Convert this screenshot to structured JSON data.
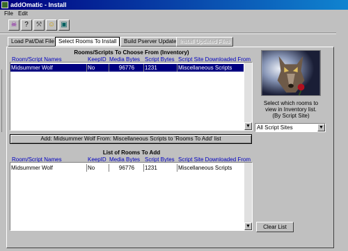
{
  "window": {
    "title": "addOmatic - Install"
  },
  "menu": {
    "file": "File",
    "edit": "Edit"
  },
  "toolbar": {
    "buttons": [
      {
        "icon": "basket-icon",
        "glyph": "☠"
      },
      {
        "icon": "help-icon",
        "glyph": "?"
      },
      {
        "icon": "tools-icon",
        "glyph": "⚒"
      },
      {
        "icon": "smiley-icon",
        "glyph": "☺"
      },
      {
        "icon": "screen-icon",
        "glyph": "▣"
      }
    ]
  },
  "tabs": [
    {
      "label": "Load Pat/Dat File",
      "state": "normal"
    },
    {
      "label": "Select Rooms To Install",
      "state": "active"
    },
    {
      "label": "Build Pserver Update",
      "state": "normal"
    },
    {
      "label": "Install Updated Files",
      "state": "disabled"
    }
  ],
  "inventory": {
    "title": "Rooms/Scripts To Choose From (Inventory)",
    "columns": [
      "Room/Script Names",
      "KeepID",
      "Media Bytes",
      "Script Bytes",
      "Script Site Downloaded From"
    ],
    "rows": [
      {
        "name": "Midsummer Wolf",
        "keep": "No",
        "media": "96776",
        "script": "1231",
        "site": "Miscellaneous Scripts",
        "selected": true
      }
    ]
  },
  "add_button": "Add: Midsummer Wolf From: Miscellaneous Scripts to 'Rooms To Add' list",
  "to_add": {
    "title": "List of Rooms To Add",
    "columns": [
      "Room/Script Names",
      "KeepID",
      "Media Bytes",
      "Script Bytes",
      "Script Site Downloaded From"
    ],
    "rows": [
      {
        "name": "Midsummer Wolf",
        "keep": "No",
        "media": "96776",
        "script": "1231",
        "site": "Miscellaneous Scripts",
        "selected": false
      }
    ]
  },
  "side_panel": {
    "help_line1": "Select which rooms to",
    "help_line2": "view in Inventory list.",
    "help_line3": "(By Script Site)",
    "site_filter": "All Script Sites",
    "clear_button": "Clear List"
  },
  "colors": {
    "title_bar": "#000080",
    "selection": "#000080",
    "link_header": "#0000c0",
    "face": "#c0c0c0"
  }
}
